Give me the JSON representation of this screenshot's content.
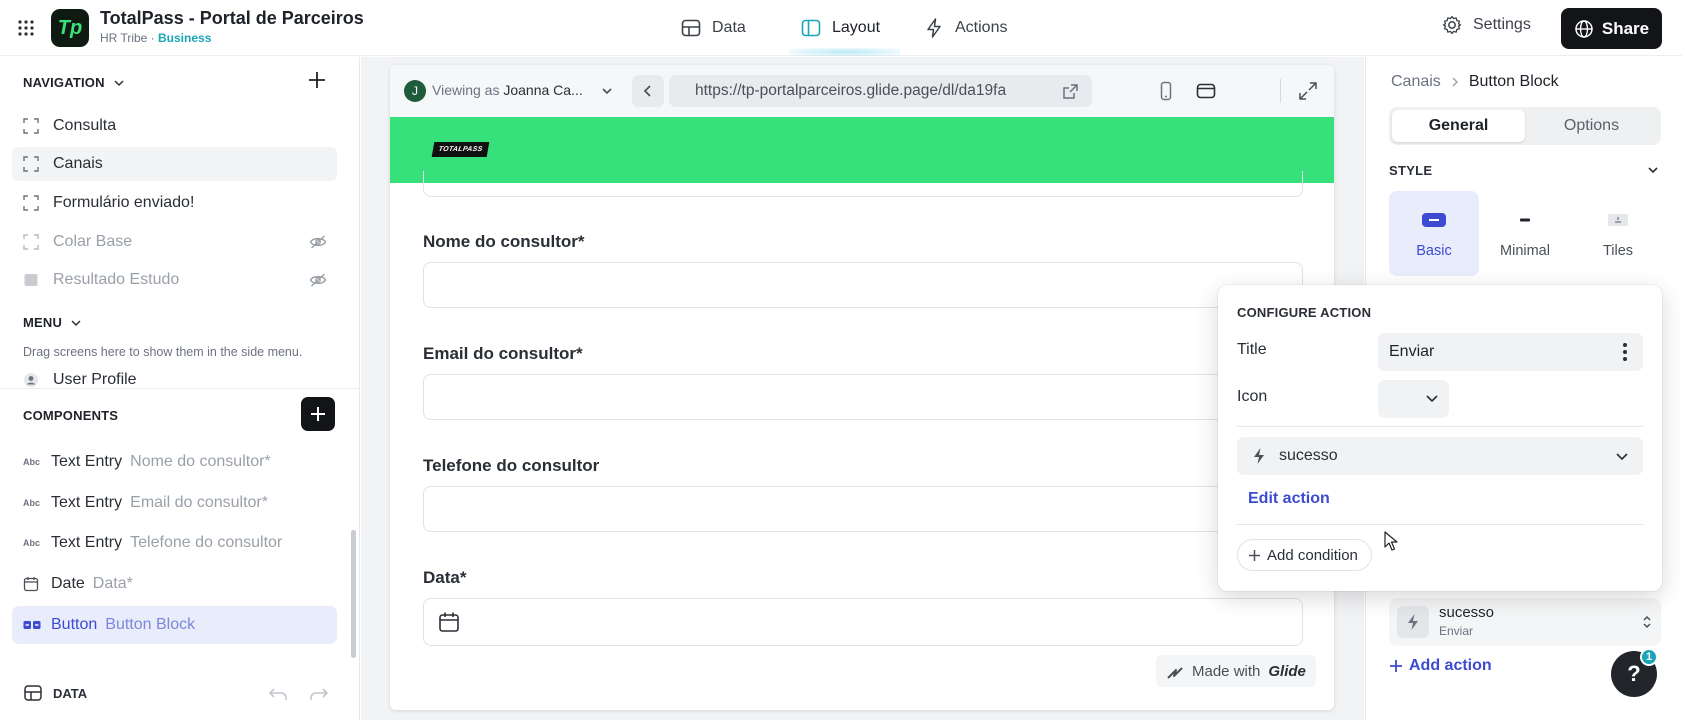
{
  "header": {
    "app_title": "TotalPass - Portal de Parceiros",
    "app_org": "HR Tribe",
    "app_sep": " · ",
    "app_plan": "Business",
    "logo_letters": "Tp",
    "tabs": [
      {
        "label": "Data",
        "icon": "table-icon"
      },
      {
        "label": "Layout",
        "icon": "layout-icon",
        "active": true
      },
      {
        "label": "Actions",
        "icon": "bolt-icon"
      }
    ],
    "settings_label": "Settings",
    "share_label": "Share"
  },
  "sidebar": {
    "navigation_title": "NAVIGATION",
    "nav_items": [
      {
        "label": "Consulta",
        "hidden": false
      },
      {
        "label": "Canais",
        "hidden": false
      },
      {
        "label": "Formulário enviado!",
        "hidden": false
      },
      {
        "label": "Colar Base",
        "hidden": true
      },
      {
        "label": "Resultado Estudo",
        "hidden": true
      }
    ],
    "menu_title": "MENU",
    "menu_hint": "Drag screens here to show them in the side menu.",
    "user_profile": "User Profile",
    "components_title": "COMPONENTS",
    "components": [
      {
        "type": "Text Entry",
        "name": "Nome do consultor*",
        "icon": "Abc"
      },
      {
        "type": "Text Entry",
        "name": "Email do consultor*",
        "icon": "Abc"
      },
      {
        "type": "Text Entry",
        "name": "Telefone do consultor",
        "icon": "Abc"
      },
      {
        "type": "Date",
        "name": "Data*",
        "icon": "calendar-icon"
      },
      {
        "type": "Button",
        "name": "Button Block",
        "icon": "button-icon",
        "selected": true
      }
    ],
    "data_label": "DATA"
  },
  "preview": {
    "viewing_prefix": "Viewing as",
    "viewing_user": "Joanna Ca...",
    "avatar_initial": "J",
    "url": "https://tp-portalparceiros.glide.page/dl/da19fa",
    "logo_text": "TOTALPASS",
    "fields": [
      {
        "label": "Nome do consultor*",
        "value": ""
      },
      {
        "label": "Email do consultor*",
        "value": ""
      },
      {
        "label": "Telefone do consultor",
        "value": ""
      },
      {
        "label": "Data*",
        "value": ""
      }
    ],
    "made_with": "Made with",
    "made_with_brand": "Glide"
  },
  "right_panel": {
    "breadcrumb_parent": "Canais",
    "breadcrumb_current": "Button Block",
    "tabs": [
      "General",
      "Options"
    ],
    "active_tab": "General",
    "style_title": "STYLE",
    "styles": [
      {
        "label": "Basic",
        "selected": true
      },
      {
        "label": "Minimal",
        "selected": false
      },
      {
        "label": "Tiles",
        "selected": false
      }
    ],
    "action_name": "sucesso",
    "action_title": "Enviar",
    "add_action": "Add action",
    "help_badge": "1"
  },
  "configure_action": {
    "title": "CONFIGURE ACTION",
    "title_label": "Title",
    "title_value": "Enviar",
    "icon_label": "Icon",
    "action_selected": "sucesso",
    "edit_action": "Edit action",
    "add_condition": "Add condition"
  },
  "colors": {
    "accent": "#3d4bd1",
    "brand_green": "#36e07a",
    "teal": "#1aa6b7"
  }
}
